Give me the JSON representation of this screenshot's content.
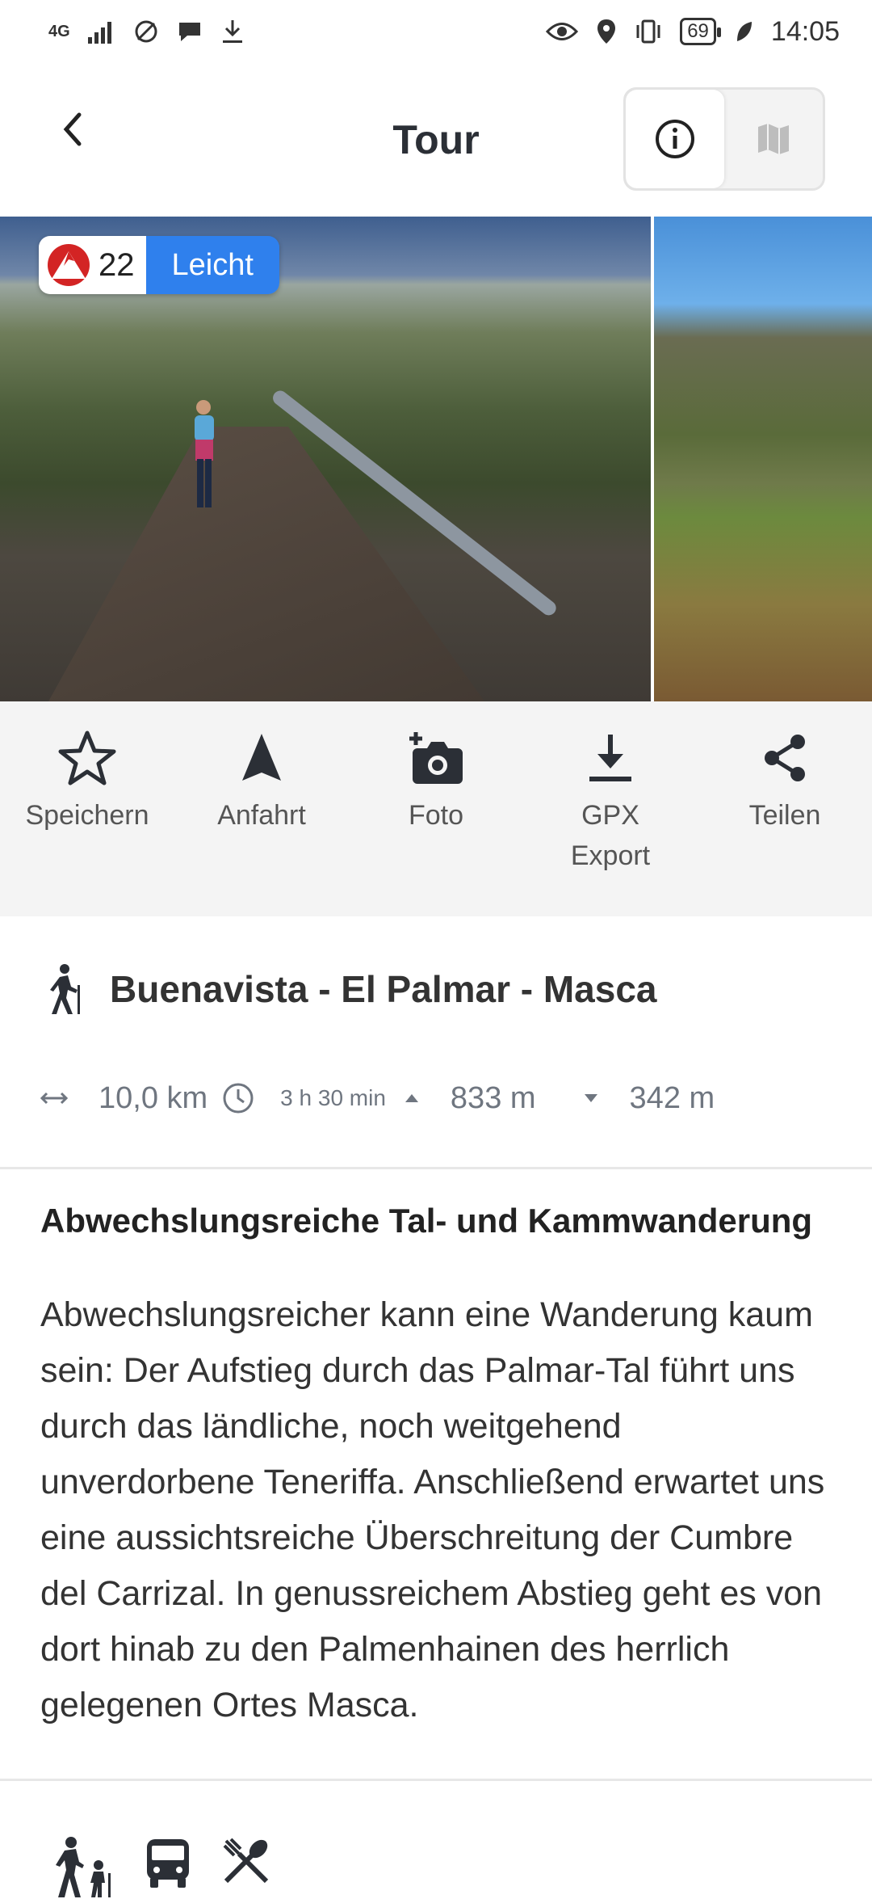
{
  "status_bar": {
    "network": "4G",
    "battery": "69",
    "time": "14:05"
  },
  "header": {
    "title": "Tour"
  },
  "hero": {
    "rating_number": "22",
    "difficulty": "Leicht",
    "difficulty_color": "#2f80ed"
  },
  "actions": [
    {
      "label": "Speichern",
      "icon": "star-icon"
    },
    {
      "label": "Anfahrt",
      "icon": "navigation-icon"
    },
    {
      "label": "Foto",
      "icon": "add-photo-icon"
    },
    {
      "label": "GPX\nExport",
      "icon": "download-icon"
    },
    {
      "label": "Teilen",
      "icon": "share-icon"
    }
  ],
  "tour": {
    "name": "Buenavista - El Palmar - Masca",
    "distance": "10,0 km",
    "duration": "3 h 30 min",
    "ascent": "833 m",
    "descent": "342 m"
  },
  "description": {
    "headline": "Abwechslungsreiche Tal- und Kammwanderung",
    "body": "Abwechslungsreicher kann eine Wanderung kaum sein: Der Aufstieg durch das Palmar-Tal führt uns durch das ländliche, noch weitgehend unverdorbene Teneriffa. Anschließend erwartet uns eine aussichtsreiche Überschreitung der Cumbre del Carrizal. In genussreichem Abstieg geht es von dort hinab zu den Palmenhainen des herrlich gelegenen Ortes Masca."
  },
  "features": [
    "family-hiking-icon",
    "bus-icon",
    "restaurant-icon"
  ]
}
